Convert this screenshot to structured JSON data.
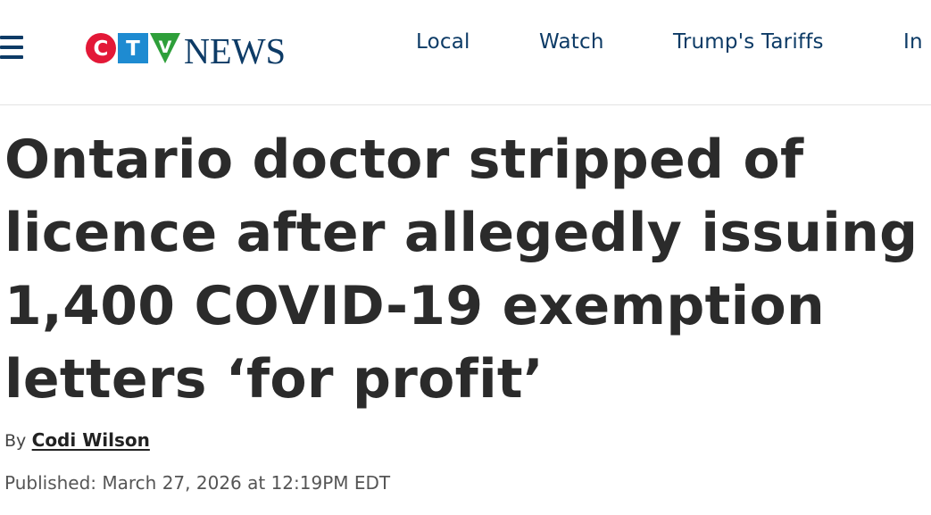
{
  "header": {
    "menu_icon": "hamburger-menu-icon",
    "logo": {
      "brand_letters": [
        "C",
        "T",
        "V"
      ],
      "wordmark": "NEWS",
      "colors": {
        "c": "#e31837",
        "t": "#1e8bd1",
        "v": "#2e9f3a",
        "wordmark": "#0d3b66"
      }
    },
    "nav": [
      {
        "label": "Local"
      },
      {
        "label": "Watch"
      },
      {
        "label": "Trump's Tariffs"
      },
      {
        "label": "In"
      }
    ],
    "nav_color": "#0d3b66"
  },
  "article": {
    "headline_lines": [
      "Ontario doctor stripped of",
      "licence after allegedly issuing",
      "1,400 COVID-19 exemption",
      "letters ‘for profit’"
    ],
    "byline_prefix": "By",
    "author": "Codi Wilson",
    "published": "Published: March 27, 2026 at 12:19PM EDT"
  }
}
